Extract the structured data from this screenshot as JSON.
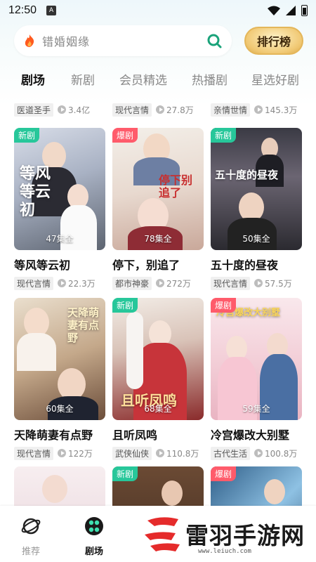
{
  "status_bar": {
    "time": "12:50",
    "notif_icon": "A"
  },
  "search": {
    "placeholder": "错婚姻缘",
    "rank_label": "排行榜"
  },
  "tabs": [
    "剧场",
    "新剧",
    "会员精选",
    "热播剧",
    "星选好剧"
  ],
  "top_row": [
    {
      "tag": "医道圣手",
      "views": "3.4亿"
    },
    {
      "tag": "现代言情",
      "views": "27.8万"
    },
    {
      "tag": "亲情世情",
      "views": "145.3万"
    }
  ],
  "cards": [
    {
      "badge": "新剧",
      "badge_type": "new",
      "episodes": "47集全",
      "title": "等风等云初",
      "tag": "现代言情",
      "views": "22.3万",
      "overlay": "等风等云初"
    },
    {
      "badge": "爆剧",
      "badge_type": "hot",
      "episodes": "78集全",
      "title": "停下，别追了",
      "tag": "都市神豪",
      "views": "272万",
      "overlay": "停下别追了"
    },
    {
      "badge": "新剧",
      "badge_type": "new",
      "episodes": "50集全",
      "title": "五十度的昼夜",
      "tag": "现代言情",
      "views": "57.5万",
      "overlay": "五十度的昼夜"
    },
    {
      "badge": "",
      "badge_type": "none",
      "episodes": "60集全",
      "title": "天降萌妻有点野",
      "tag": "现代言情",
      "views": "122万",
      "overlay": "天降萌妻有点野"
    },
    {
      "badge": "新剧",
      "badge_type": "new",
      "episodes": "68集全",
      "title": "且听凤鸣",
      "tag": "武侠仙侠",
      "views": "110.8万",
      "overlay": "且听凤鸣"
    },
    {
      "badge": "爆剧",
      "badge_type": "hot",
      "episodes": "59集全",
      "title": "冷宫爆改大别墅",
      "tag": "古代生活",
      "views": "100.8万",
      "overlay": "冷宫爆改大别墅"
    },
    {
      "badge": "",
      "badge_type": "none",
      "episodes": "",
      "title": "",
      "tag": "",
      "views": ""
    },
    {
      "badge": "新剧",
      "badge_type": "new",
      "episodes": "",
      "title": "",
      "tag": "",
      "views": ""
    },
    {
      "badge": "爆剧",
      "badge_type": "hot",
      "episodes": "",
      "title": "",
      "tag": "",
      "views": ""
    }
  ],
  "bottom_nav": [
    {
      "label": "推荐",
      "icon": "planet-icon"
    },
    {
      "label": "剧场",
      "icon": "theater-icon"
    }
  ],
  "watermark": {
    "text": "雷羽手游网",
    "url": "www.leiuch.com"
  },
  "colors": {
    "new_badge": "#27c79a",
    "hot_badge": "#ff5b6b",
    "rank_gold": "#f0c873"
  }
}
